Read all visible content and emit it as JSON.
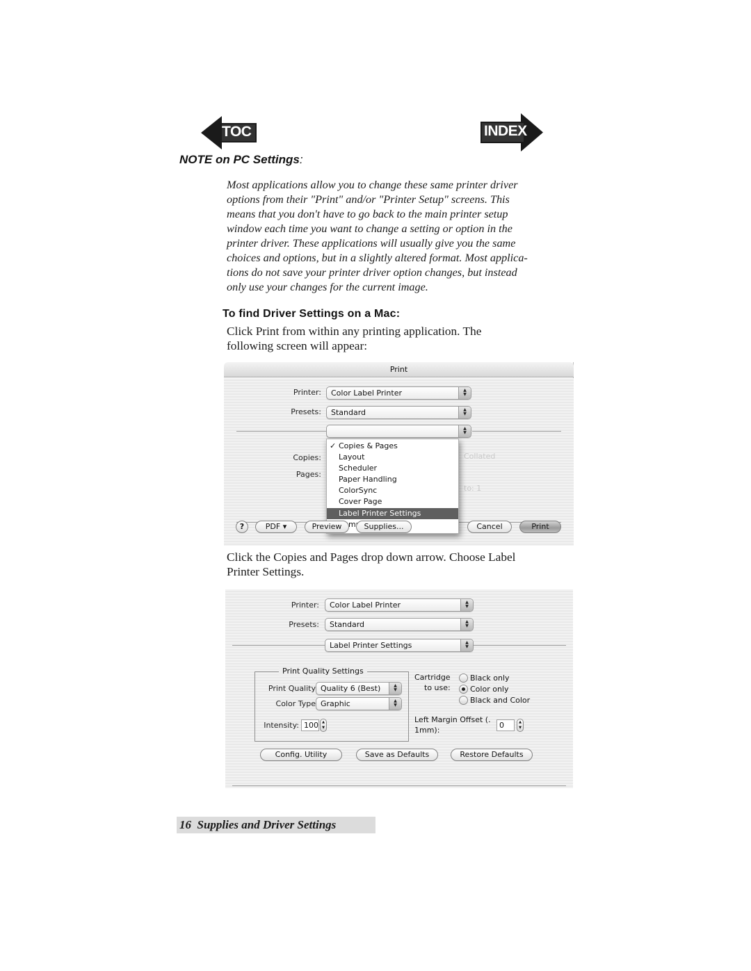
{
  "nav": {
    "toc_label": "TOC",
    "index_label": "INDEX"
  },
  "note": {
    "heading": "NOTE on PC Settings",
    "heading_suffix": ":",
    "lines": [
      "Most applications allow you to change these same printer driver",
      "options from their \"Print\" and/or \"Printer Setup\" screens. This",
      "means that you don't have to go back to the main printer setup",
      "window each time you want to change a setting or option in the",
      "printer driver. These applications will usually give you the same",
      "choices and options, but in a slightly altered format. Most applica-",
      "tions do not save your printer driver option changes, but instead",
      "only use your changes for the current image."
    ]
  },
  "section": {
    "heading": "To find Driver Settings on a Mac:",
    "para1_lines": [
      "Click Print from within any printing application.  The",
      "following screen will appear:"
    ],
    "para2_lines": [
      "Click the Copies and Pages drop down arrow.  Choose Label",
      "Printer Settings."
    ]
  },
  "print_dialog": {
    "title": "Print",
    "printer_label": "Printer:",
    "printer_value": "Color Label Printer",
    "presets_label": "Presets:",
    "presets_value": "Standard",
    "copies_label": "Copies:",
    "pages_label": "Pages:",
    "ghost_collated": "Collated",
    "ghost_to": "to:",
    "ghost_one": "1",
    "menu_items": [
      {
        "label": "Copies & Pages",
        "checked": true,
        "selected": false
      },
      {
        "label": "Layout",
        "checked": false,
        "selected": false
      },
      {
        "label": "Scheduler",
        "checked": false,
        "selected": false
      },
      {
        "label": "Paper Handling",
        "checked": false,
        "selected": false
      },
      {
        "label": "ColorSync",
        "checked": false,
        "selected": false
      },
      {
        "label": "Cover Page",
        "checked": false,
        "selected": false
      },
      {
        "label": "Label Printer Settings",
        "checked": false,
        "selected": true
      },
      {
        "label": "Summary",
        "checked": false,
        "selected": false
      }
    ],
    "check_glyph": "✓",
    "buttons": {
      "help": "?",
      "pdf": "PDF ▾",
      "preview": "Preview",
      "supplies": "Supplies...",
      "cancel": "Cancel",
      "print": "Print"
    }
  },
  "label_settings": {
    "printer_label": "Printer:",
    "printer_value": "Color Label Printer",
    "presets_label": "Presets:",
    "presets_value": "Standard",
    "panel_value": "Label Printer Settings",
    "group_title": "Print Quality Settings",
    "print_quality_label": "Print Quality",
    "print_quality_value": "Quality 6 (Best)",
    "color_type_label": "Color Type",
    "color_type_value": "Graphic",
    "intensity_label": "Intensity:",
    "intensity_value": "100",
    "cartridge_label_line1": "Cartridge",
    "cartridge_label_line2": "to use:",
    "cartridge_options": [
      {
        "label": "Black only",
        "selected": false
      },
      {
        "label": "Color only",
        "selected": true
      },
      {
        "label": "Black and Color",
        "selected": false
      }
    ],
    "left_margin_label_line1": "Left Margin Offset (.",
    "left_margin_label_line2": "1mm):",
    "left_margin_value": "0",
    "buttons": {
      "config_utility": "Config. Utility",
      "save_defaults": "Save as Defaults",
      "restore_defaults": "Restore Defaults"
    }
  },
  "footer": {
    "page_number": "16",
    "section_title": "Supplies and Driver Settings"
  }
}
